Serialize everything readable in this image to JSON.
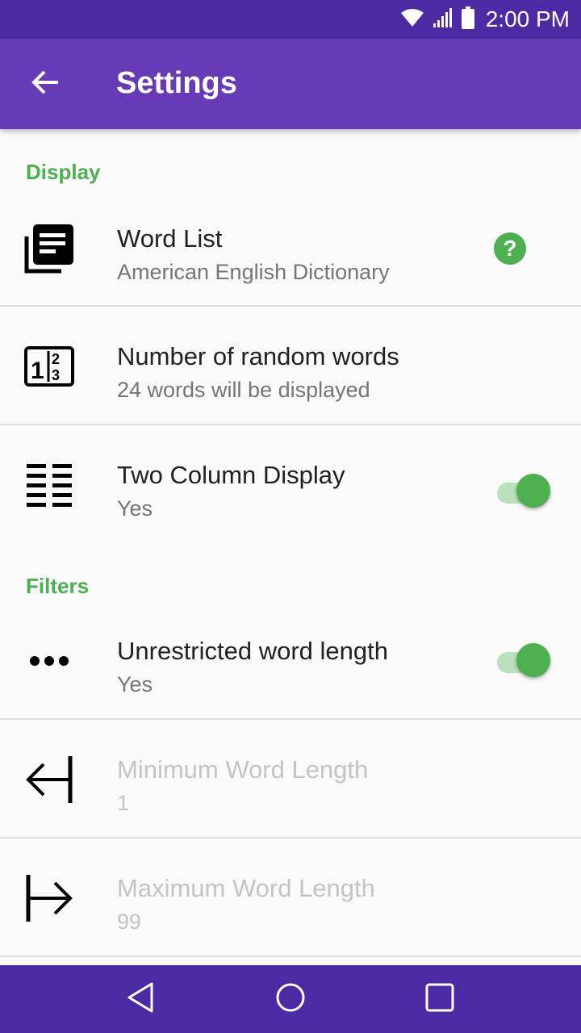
{
  "status_bar": {
    "time": "2:00 PM",
    "icons": [
      "wifi-icon",
      "signal-icon",
      "battery-icon"
    ]
  },
  "app_bar": {
    "title": "Settings",
    "back_icon": "arrow-back-icon"
  },
  "categories": {
    "display": "Display",
    "filters": "Filters"
  },
  "preferences": {
    "word_list": {
      "title": "Word List",
      "summary": "American English Dictionary",
      "icon": "library-books-icon",
      "action_icon": "help-icon",
      "action_glyph": "?"
    },
    "random_words": {
      "title": "Number of random words",
      "summary": "24 words will be displayed",
      "icon": "numbered-grid-icon"
    },
    "two_column": {
      "title": "Two Column Display",
      "summary": "Yes",
      "icon": "two-column-list-icon",
      "enabled": true
    },
    "unrestricted_length": {
      "title": "Unrestricted word length",
      "summary": "Yes",
      "icon": "more-horiz-icon",
      "enabled": true
    },
    "min_length": {
      "title": "Minimum Word Length",
      "summary": "1",
      "icon": "arrow-left-bar-icon",
      "disabled": true
    },
    "max_length": {
      "title": "Maximum Word Length",
      "summary": "99",
      "icon": "arrow-right-bar-icon",
      "disabled": true
    }
  },
  "nav_bar": {
    "buttons": [
      "back-triangle-icon",
      "home-circle-icon",
      "recents-square-icon"
    ]
  },
  "colors": {
    "status_bar": "#4a2ba3",
    "app_bar": "#673ab7",
    "accent": "#4caf50",
    "nav_bar": "#4a2ba3"
  }
}
